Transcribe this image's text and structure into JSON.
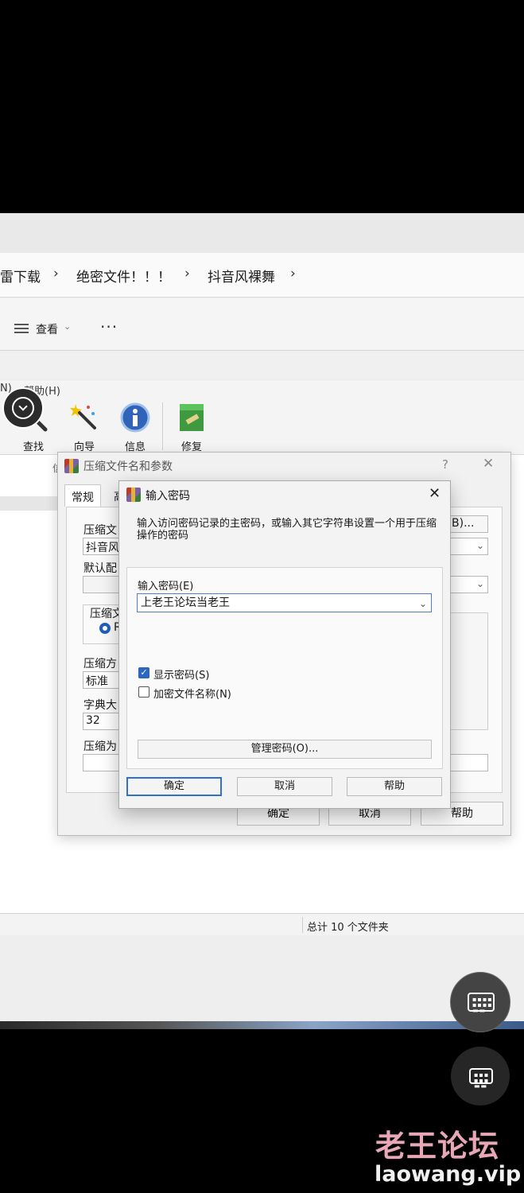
{
  "explorer": {
    "breadcrumb": [
      "雷下载",
      "绝密文件！！！",
      "抖音风裸舞"
    ],
    "breadcrumb_sep": "›",
    "toolbar": {
      "view_label": "查看",
      "view_caret": "⌄",
      "more_label": "···"
    }
  },
  "winrar": {
    "menu_partial": [
      "N)",
      "帮助(H)"
    ],
    "tools": [
      {
        "label": "查找",
        "icon": "find-icon"
      },
      {
        "label": "向导",
        "icon": "wizard-icon"
      },
      {
        "label": "信息",
        "icon": "info-icon"
      },
      {
        "label": "修复",
        "icon": "repair-icon"
      }
    ],
    "status": "总计 10 个文件夹",
    "list_col_partial": "信"
  },
  "archive_dialog": {
    "title": "压缩文件名和参数",
    "help_glyph": "?",
    "close_glyph": "✕",
    "tabs": [
      "常规",
      "高"
    ],
    "fields": {
      "archive_name_label": "压缩文",
      "archive_name_value": "抖音风",
      "browse_label": "B)...",
      "default_profile_label": "默认配",
      "archive_format_label": "压缩文",
      "format_radio_label": "R",
      "method_label": "压缩方",
      "method_value": "标准",
      "dict_label": "字典大",
      "dict_value": "32",
      "split_label": "压缩为"
    },
    "buttons": {
      "ok": "确定",
      "cancel": "取消",
      "help": "帮助"
    }
  },
  "password_dialog": {
    "title": "输入密码",
    "close_glyph": "✕",
    "message": "输入访问密码记录的主密码，或输入其它字符串设置一个用于压缩操作的密码",
    "password_label": "输入密码(E)",
    "password_value": "上老王论坛当老王",
    "show_password_label": "显示密码(S)",
    "show_password_checked": true,
    "encrypt_names_label": "加密文件名称(N)",
    "encrypt_names_checked": false,
    "manage_button": "管理密码(O)...",
    "buttons": {
      "ok": "确定",
      "cancel": "取消",
      "help": "帮助"
    }
  },
  "watermark": {
    "cn": "老王论坛",
    "en": "laowang.vip"
  },
  "colors": {
    "accent": "#2f6fd0",
    "watermark_cn": "#e7a7b6"
  }
}
